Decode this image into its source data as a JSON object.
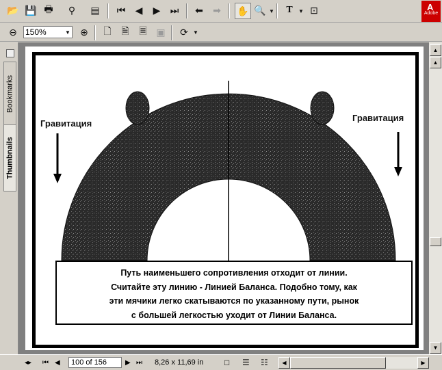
{
  "toolbar": {
    "zoom_value": "150%",
    "adobe_label": "Adobe"
  },
  "left_panel": {
    "tabs": [
      {
        "label": "Bookmarks"
      },
      {
        "label": "Thumbnails"
      }
    ]
  },
  "document": {
    "gravity_left": "Гравитация",
    "gravity_right": "Гравитация",
    "caption_lines": [
      "Путь наименьшего сопротивления отходит от линии.",
      "Считайте эту линию - Линией Баланса. Подобно тому, как",
      "эти мячики легко скатываются по указанному пути, рынок",
      "с большей легкостью уходит от Линии Баланса."
    ]
  },
  "status_bar": {
    "page_indicator": "100 of 156",
    "page_size": "8,26 x 11,69 in"
  }
}
